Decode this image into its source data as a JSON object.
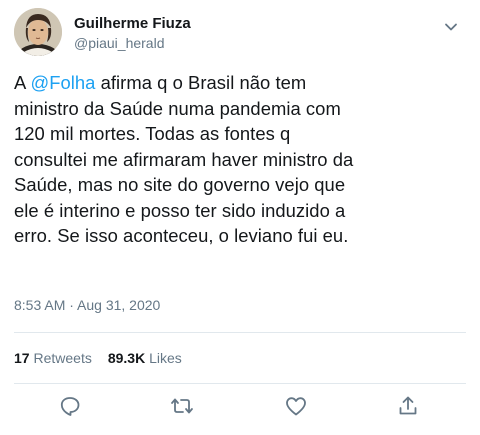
{
  "user": {
    "display_name": "Guilherme Fiuza",
    "handle": "@piaui_herald"
  },
  "tweet": {
    "text_before_mention": "A ",
    "mention": "@Folha",
    "text_after_mention": " afirma q o Brasil não tem\nministro da Saúde numa pandemia com\n120 mil mortes. Todas as fontes q\nconsultei me afirmaram haver ministro da\nSaúde, mas no site do governo vejo que\nele é interino e posso ter sido induzido a\nerro. Se isso aconteceu, o leviano fui eu.",
    "timestamp": "8:53 AM · Aug 31, 2020"
  },
  "stats": {
    "retweets_count": "17",
    "retweets_label": "Retweets",
    "likes_count": "89.3K",
    "likes_label": "Likes"
  },
  "actions": [
    {
      "icon": "reply-icon"
    },
    {
      "icon": "retweet-icon"
    },
    {
      "icon": "like-icon"
    },
    {
      "icon": "share-icon"
    }
  ],
  "colors": {
    "link": "#1da1f2",
    "text": "#14171a",
    "secondary": "#657786",
    "divider": "#e1e8ed"
  }
}
